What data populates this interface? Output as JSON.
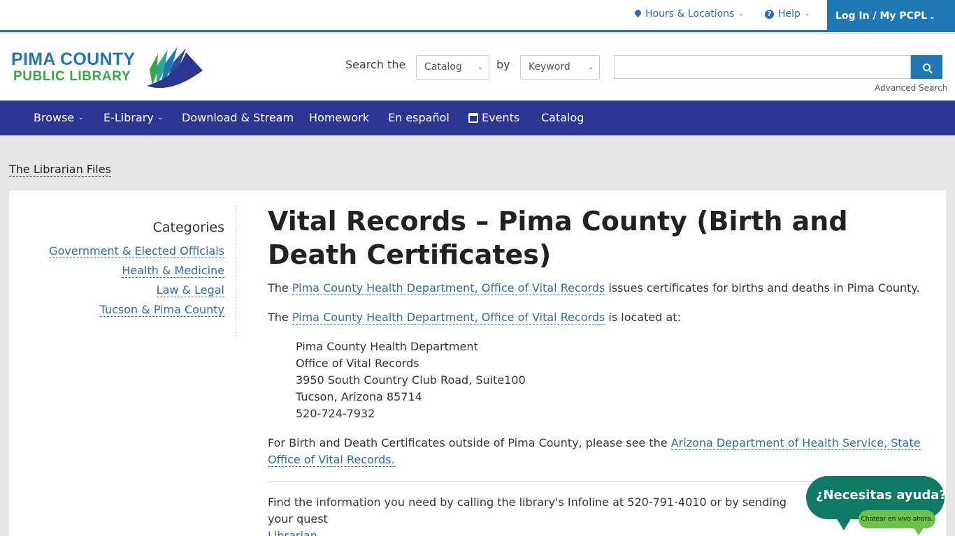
{
  "topbar": {
    "hours_label": "Hours & Locations",
    "help_label": "Help",
    "login_label": "Log In / My PCPL"
  },
  "logo": {
    "line1": "PIMA COUNTY",
    "line2": "PUBLIC LIBRARY"
  },
  "search": {
    "search_the_label": "Search the",
    "scope_selected": "Catalog",
    "by_label": "by",
    "field_selected": "Keyword",
    "query_value": "",
    "advanced_label": "Advanced Search"
  },
  "nav": {
    "items": [
      {
        "label": "Browse"
      },
      {
        "label": "E-Library"
      },
      {
        "label": "Download & Stream"
      },
      {
        "label": "Homework"
      },
      {
        "label": "En español"
      },
      {
        "label": "Events"
      },
      {
        "label": "Catalog"
      }
    ]
  },
  "breadcrumb": {
    "label": "The Librarian Files"
  },
  "sidebar": {
    "title": "Categories",
    "items": [
      {
        "label": "Government & Elected Officials"
      },
      {
        "label": "Health & Medicine"
      },
      {
        "label": "Law & Legal"
      },
      {
        "label": "Tucson & Pima County"
      }
    ]
  },
  "article": {
    "title": "Vital Records – Pima County (Birth and Death Certificates)",
    "p1_prefix": "The ",
    "p1_link": "Pima County Health Department, Office of Vital Records",
    "p1_suffix": " issues certificates for births and deaths in Pima County.",
    "p2_prefix": "The ",
    "p2_link": "Pima County Health Department, Office of Vital Records",
    "p2_suffix": " is located at:",
    "address": [
      "Pima County Health Department",
      "Office of Vital Records",
      "3950 South Country Club Road, Suite100",
      "Tucson, Arizona 85714",
      "520-724-7932"
    ],
    "p3_prefix": "For Birth and Death Certificates outside of Pima County, please see the ",
    "p3_link": "Arizona Department of Health Service, State Office of Vital Records.",
    "p4_text": "Find the information you need by calling the library's Infoline at 520-791-4010 or by sending your quest",
    "p4_link": "Librarian",
    "p4_suffix": "."
  },
  "chat": {
    "main_label": "¿Necesitas ayuda?",
    "sub_label": "Chatear en vivo ahora."
  },
  "colors": {
    "brand_blue": "#1f78b4",
    "nav_indigo": "#2c3590",
    "brand_green": "#3aa641",
    "chat_teal": "#0f7a65",
    "chat_green": "#6cc24a"
  }
}
